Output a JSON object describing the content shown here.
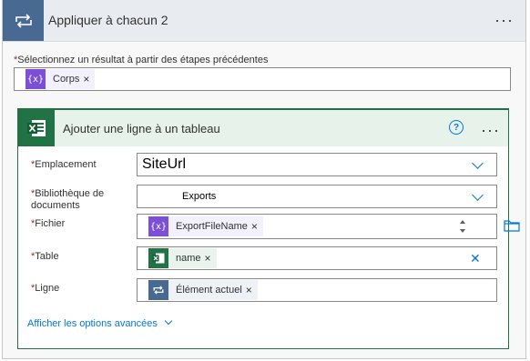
{
  "loop": {
    "title": "Appliquer à chacun 2",
    "more_label": "···",
    "select_label": "Sélectionnez un résultat à partir des étapes précédentes",
    "required_mark": "*",
    "token": {
      "label": "Corps",
      "icon": "{x}",
      "remove": "×"
    }
  },
  "action": {
    "title": "Ajouter une ligne à un tableau",
    "help_label": "?",
    "more_label": "···",
    "fields": {
      "location": {
        "label": "Emplacement",
        "value": "SiteUrl"
      },
      "library": {
        "label": "Bibliothèque de documents",
        "value": "Exports"
      },
      "file": {
        "label": "Fichier",
        "token": "ExportFileName",
        "icon": "{x}",
        "remove": "×"
      },
      "table": {
        "label": "Table",
        "token": "name",
        "remove": "×",
        "clear": "✕"
      },
      "row": {
        "label": "Ligne",
        "token": "Élément actuel",
        "remove": "×"
      }
    },
    "advanced_label": "Afficher les options avancées"
  },
  "colors": {
    "loop_accent": "#486991",
    "excel_accent": "#217346",
    "dynamic_content": "#7b50d6",
    "link": "#0078d4",
    "required": "#a4262c"
  },
  "icons": [
    "loop-icon",
    "excel-icon",
    "help-icon",
    "more-icon",
    "chevron-down-icon",
    "folder-icon",
    "close-icon",
    "spinner-up-icon",
    "spinner-down-icon"
  ]
}
